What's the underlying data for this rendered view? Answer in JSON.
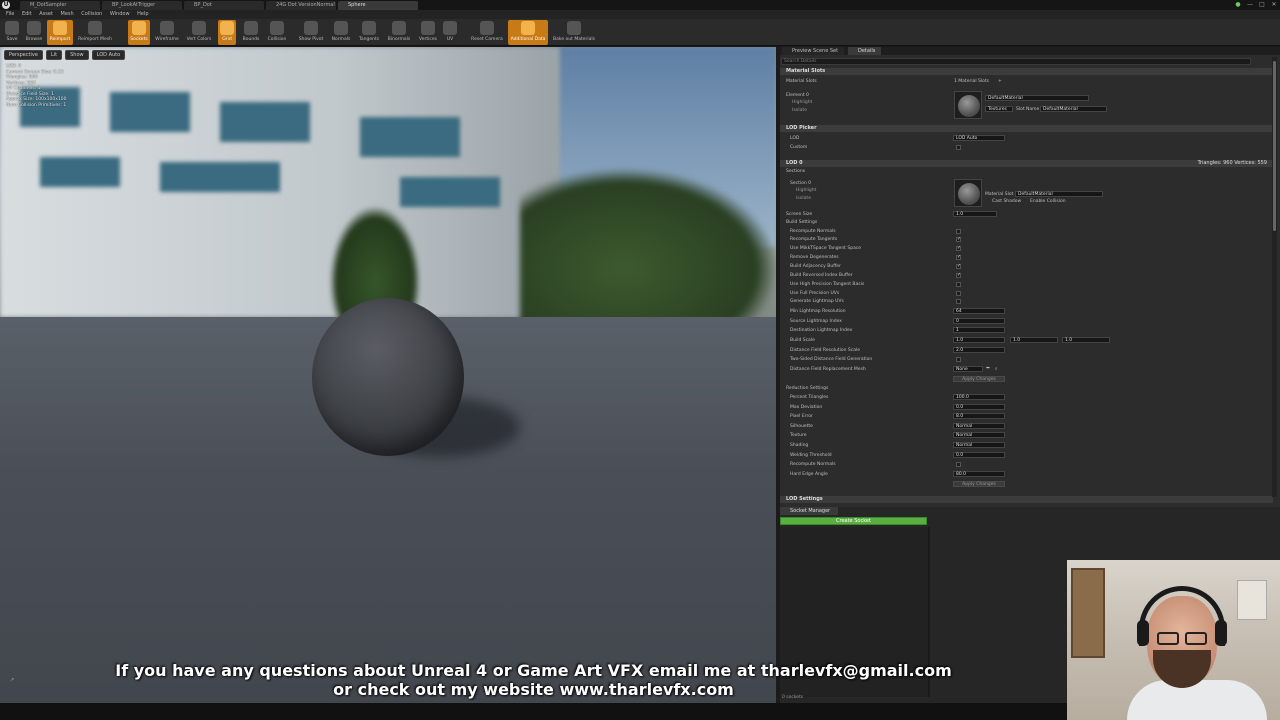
{
  "tabs": [
    "M_DotSampler",
    "BP_LookAtTrigger",
    "BP_Dot",
    "24G Dot VersionNormal",
    "Sphere"
  ],
  "menu": [
    "File",
    "Edit",
    "Asset",
    "Mesh",
    "Collision",
    "Window",
    "Help"
  ],
  "toolbar": [
    "Save",
    "Browse",
    "Reimport",
    "Reimport Mesh",
    "Sockets",
    "Wireframe",
    "Vert Colors",
    "Grid",
    "Bounds",
    "Collision",
    "Show Pivot",
    "Normals",
    "Tangents",
    "Binormals",
    "Vertices",
    "UV",
    "Reset Camera",
    "Additional Data",
    "Bake out Materials"
  ],
  "viewport": {
    "buttons": [
      "Perspective",
      "Lit",
      "Show",
      "LOD Auto"
    ],
    "info": [
      "LOD: 0",
      "Current Screen Size: 0.23",
      "Triangles: 960",
      "Vertices: 559",
      "UV Channels: 1",
      "Distance Field Size: 1",
      "Approx Size: 100x100x100",
      "Num Collision Primitives: 1"
    ]
  },
  "panel": {
    "tabs": [
      "Preview Scene Set",
      "Details"
    ],
    "search_placeholder": "Search Details",
    "material_slots": {
      "header": "Material Slots",
      "label": "Material Slots",
      "count": "1 Material Slots",
      "element": "Element 0",
      "highlight": "Highlight",
      "isolate": "Isolate",
      "material": "DefaultMaterial",
      "textures": "Textures",
      "slot_name_label": "Slot Name",
      "slot_name": "DefaultMaterial"
    },
    "lod_picker": {
      "header": "LOD Picker",
      "lod_label": "LOD",
      "lod_value": "LOD Auto",
      "custom_label": "Custom"
    },
    "lod0": {
      "header": "LOD 0",
      "stats": "Triangles: 960   Vertices: 559",
      "sections": "Sections",
      "section": "Section 0",
      "highlight": "Highlight",
      "isolate": "Isolate",
      "material_slot_label": "Material Slot",
      "material_slot_value": "DefaultMaterial",
      "cast_shadow": "Cast Shadow",
      "enable_collision": "Enable Collision",
      "screen_size_label": "Screen Size",
      "screen_size_value": "1.0",
      "build_settings": "Build Settings",
      "build_rows": [
        {
          "label": "Recompute Normals",
          "checked": false
        },
        {
          "label": "Recompute Tangents",
          "checked": true
        },
        {
          "label": "Use MikkTSpace Tangent Space",
          "checked": true
        },
        {
          "label": "Remove Degenerates",
          "checked": true
        },
        {
          "label": "Build Adjacency Buffer",
          "checked": true
        },
        {
          "label": "Build Reversed Index Buffer",
          "checked": true
        },
        {
          "label": "Use High Precision Tangent Basis",
          "checked": false
        },
        {
          "label": "Use Full Precision UVs",
          "checked": false
        },
        {
          "label": "Generate Lightmap UVs",
          "checked": false
        }
      ],
      "min_lightmap_label": "Min Lightmap Resolution",
      "min_lightmap_value": "64",
      "source_lightmap_label": "Source Lightmap Index",
      "source_lightmap_value": "0",
      "dest_lightmap_label": "Destination Lightmap Index",
      "dest_lightmap_value": "1",
      "build_scale_label": "Build Scale",
      "build_scale_x": "1.0",
      "build_scale_y": "1.0",
      "build_scale_z": "1.0",
      "df_res_label": "Distance Field Resolution Scale",
      "df_res_value": "2.0",
      "two_sided_label": "Two-Sided Distance Field Generation",
      "df_replace_label": "Distance Field Replacement Mesh",
      "df_replace_value": "None",
      "apply": "Apply Changes",
      "reduction": "Reduction Settings",
      "reduction_rows": [
        {
          "label": "Percent Triangles",
          "value": "100.0"
        },
        {
          "label": "Max Deviation",
          "value": "0.0"
        },
        {
          "label": "Pixel Error",
          "value": "8.0"
        },
        {
          "label": "Silhouette",
          "value": "Normal"
        },
        {
          "label": "Texture",
          "value": "Normal"
        },
        {
          "label": "Shading",
          "value": "Normal"
        },
        {
          "label": "Welding Threshold",
          "value": "0.0"
        },
        {
          "label": "Recompute Normals",
          "value": ""
        },
        {
          "label": "Hard Edge Angle",
          "value": "80.0"
        }
      ]
    },
    "lod_settings": "LOD Settings"
  },
  "socket_manager": {
    "tab": "Socket Manager",
    "create": "Create Socket",
    "count": "0 sockets"
  },
  "caption": {
    "line1": "If you have any questions about Unreal 4 or Game Art VFX email me at tharlevfx@gmail.com",
    "line2": "or check out my website www.tharlevfx.com"
  }
}
